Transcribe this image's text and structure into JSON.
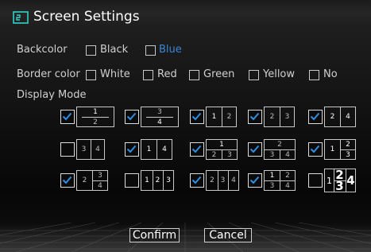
{
  "window": {
    "title": "Screen Settings"
  },
  "settings": {
    "backcolor": {
      "label": "Backcolor",
      "options": [
        "Black",
        "Blue"
      ],
      "selected": "Blue"
    },
    "border_color": {
      "label": "Border color",
      "options": [
        "White",
        "Red",
        "Green",
        "Yellow",
        "No"
      ]
    },
    "display_mode": {
      "label": "Display Mode"
    }
  },
  "display_modes": [
    {
      "checked": true,
      "numbers": [
        "1",
        "2"
      ]
    },
    {
      "checked": true,
      "numbers": [
        "3",
        "4"
      ]
    },
    {
      "checked": true,
      "numbers": [
        "1",
        "2"
      ]
    },
    {
      "checked": true,
      "numbers": [
        "2",
        "3"
      ]
    },
    {
      "checked": true,
      "numbers": [
        "2",
        "4"
      ]
    },
    {
      "checked": false,
      "numbers": [
        "3",
        "4"
      ]
    },
    {
      "checked": true,
      "numbers": [
        "1",
        "4"
      ]
    },
    {
      "checked": true,
      "numbers": [
        "1",
        "2",
        "3"
      ]
    },
    {
      "checked": true,
      "numbers": [
        "2",
        "3",
        "4"
      ]
    },
    {
      "checked": true,
      "numbers": [
        "1",
        "2",
        "3"
      ]
    },
    {
      "checked": true,
      "numbers": [
        "2",
        "3",
        "4"
      ]
    },
    {
      "checked": false,
      "numbers": [
        "1",
        "2",
        "3"
      ]
    },
    {
      "checked": true,
      "numbers": [
        "2",
        "3",
        "4"
      ]
    },
    {
      "checked": true,
      "numbers": [
        "1",
        "2",
        "3",
        "4"
      ]
    },
    {
      "checked": false,
      "numbers": [
        "1",
        "2",
        "3",
        "4"
      ]
    }
  ],
  "footer": {
    "confirm_label": "Confirm",
    "cancel_label": "Cancel"
  },
  "colors": {
    "accent_blue": "#3a86d6",
    "check_blue": "#2f8ee0",
    "text": "#d0d0d0"
  },
  "icons": {
    "title": "screen-layout-icon",
    "check": "check-icon"
  }
}
